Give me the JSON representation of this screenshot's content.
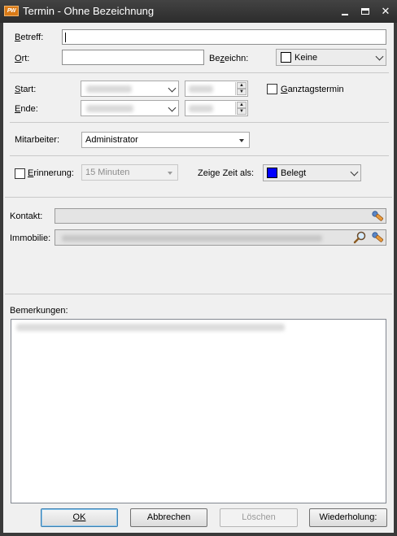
{
  "window": {
    "title": "Termin - Ohne Bezeichnung",
    "logo_text": "PW"
  },
  "form": {
    "betreff": {
      "label_first": "B",
      "label_rest": "etreff:",
      "value": ""
    },
    "ort": {
      "label_first": "O",
      "label_rest": "rt:",
      "value": ""
    },
    "bezeichn": {
      "label_pre": "Be",
      "label_ul": "z",
      "label_rest": "eichn:",
      "value": "Keine",
      "color": "#ffffff"
    },
    "start": {
      "label_first": "S",
      "label_rest": "tart:"
    },
    "ende": {
      "label_first": "E",
      "label_rest": "nde:"
    },
    "ganztag": {
      "label_first": "G",
      "label_rest": "anztagstermin",
      "checked": false
    },
    "mitarbeiter": {
      "label": "Mitarbeiter:",
      "value": "Administrator"
    },
    "erinnerung": {
      "label_first": "E",
      "label_rest": "rinnerung:",
      "checked": false,
      "value": "15 Minuten"
    },
    "zeige_zeit": {
      "label": "Zeige Zeit als:",
      "value": "Belegt",
      "color": "#0000ff"
    },
    "kontakt": {
      "label": "Kontakt:"
    },
    "immobilie": {
      "label": "Immobilie:"
    },
    "bemerkungen": {
      "label": "Bemerkungen:"
    }
  },
  "buttons": {
    "ok": "OK",
    "abbrechen": "Abbrechen",
    "loeschen": "Löschen",
    "wiederholung": "Wiederholung:"
  },
  "icons": {
    "logo": "app-logo-icon",
    "kontakt_pick": "contact-picker-icon",
    "immobilie_search": "magnifier-search-icon",
    "immobilie_pick": "property-picker-icon"
  }
}
